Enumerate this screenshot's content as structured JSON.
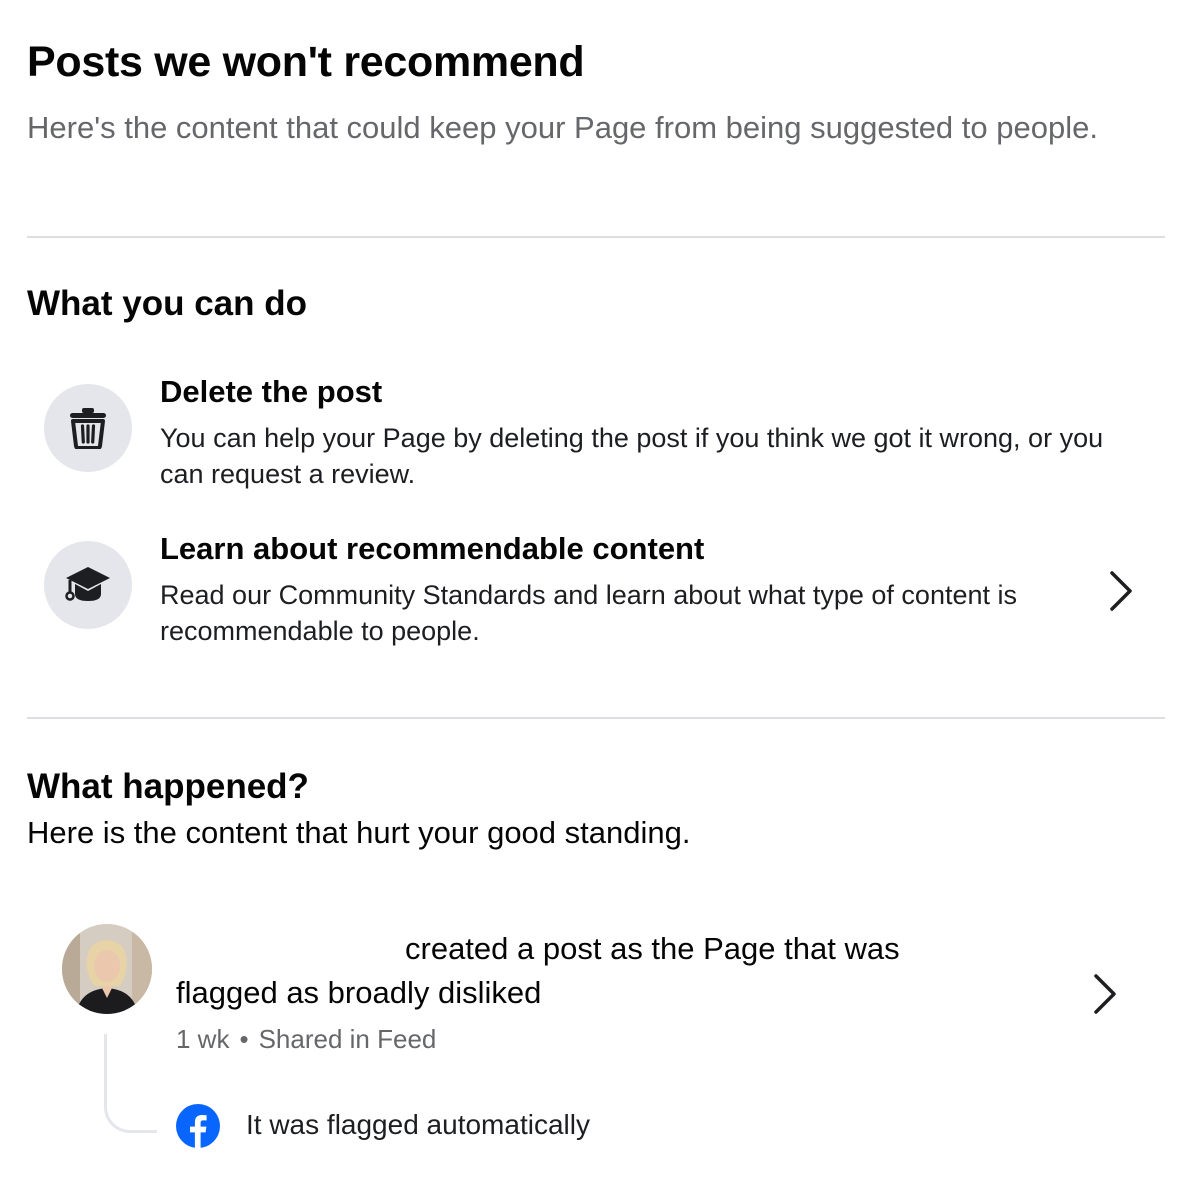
{
  "header": {
    "title": "Posts we won't recommend",
    "subtitle": "Here's the content that could keep your Page from being suggested to people."
  },
  "what_you_can_do": {
    "heading": "What you can do",
    "actions": [
      {
        "icon": "trash-icon",
        "title": "Delete the post",
        "description": "You can help your Page by deleting the post if you think we got it wrong, or you can request a review."
      },
      {
        "icon": "graduation-cap-icon",
        "title": "Learn about recommendable content",
        "description": "Read our Community Standards and learn about what type of content is recommendable to people.",
        "chevron": "chevron-right-icon"
      }
    ]
  },
  "what_happened": {
    "heading": "What happened?",
    "description": "Here is the content that hurt your good standing.",
    "post": {
      "line1": "created a post as the Page that was",
      "line2": "flagged as broadly disliked",
      "time": "1 wk",
      "separator": "•",
      "shared_in": "Shared in Feed",
      "chevron": "chevron-right-icon"
    },
    "flag_source": {
      "icon": "facebook-icon",
      "text": "It was flagged automatically"
    }
  },
  "colors": {
    "primary_text": "#050505",
    "secondary_text": "#65676b",
    "divider": "#dcdee1",
    "icon_background": "#e4e6eb",
    "facebook_blue": "#0866ff"
  }
}
